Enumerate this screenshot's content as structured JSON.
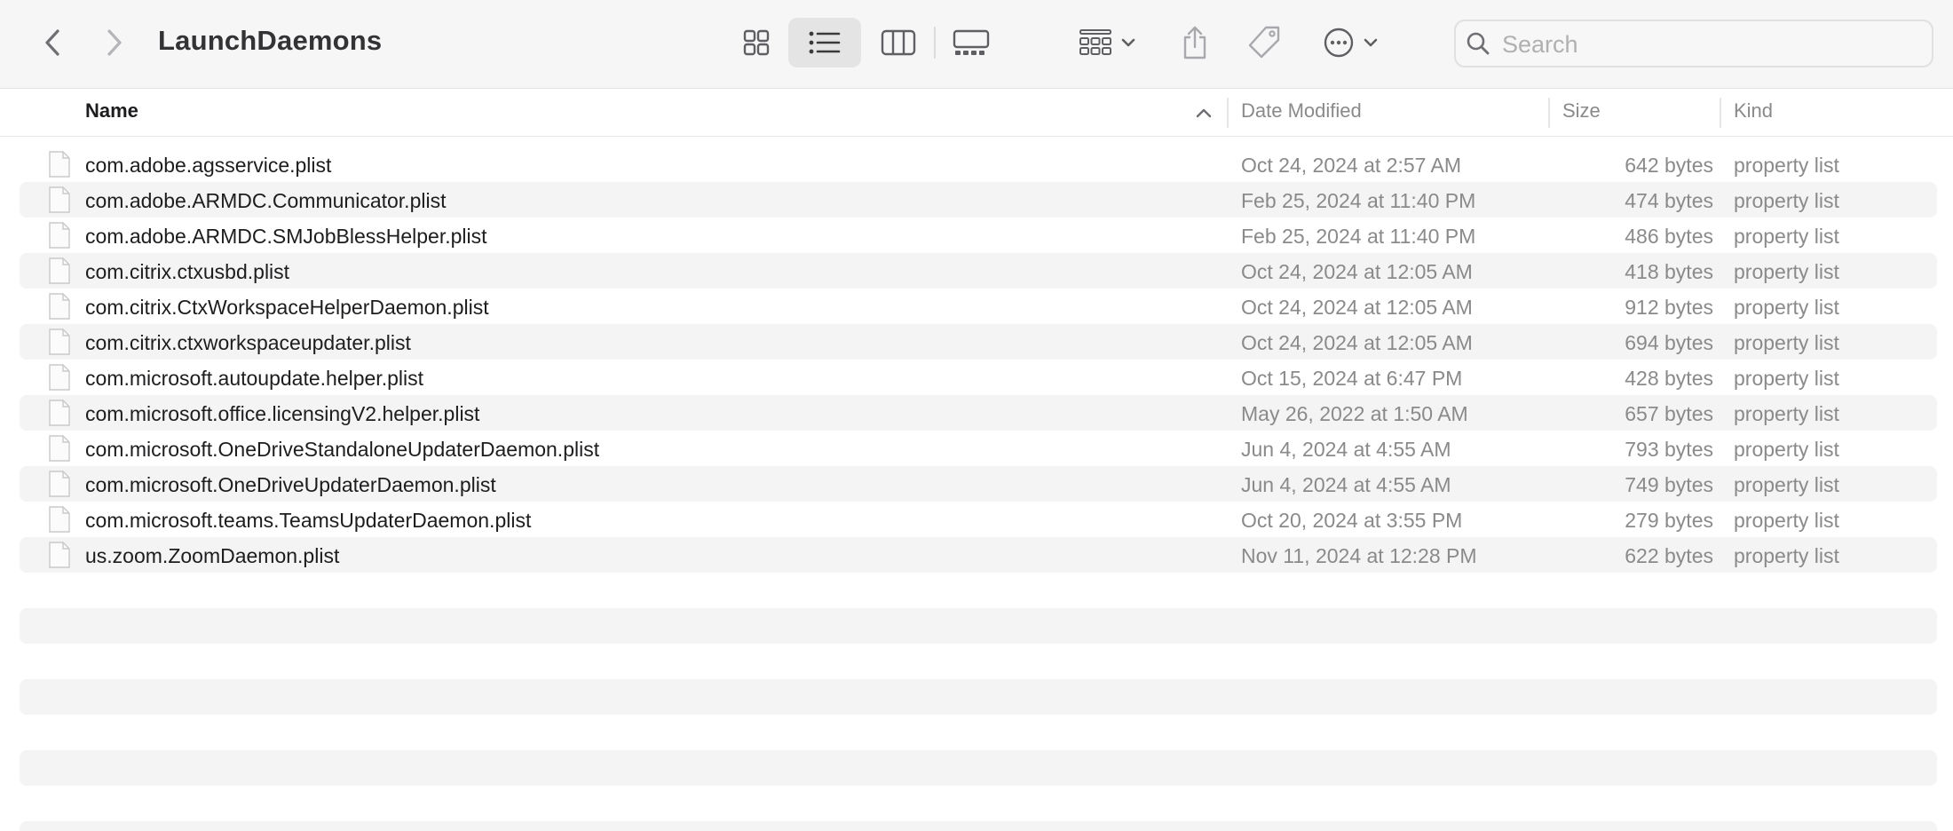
{
  "window": {
    "title": "LaunchDaemons"
  },
  "toolbar": {
    "back_icon": "chevron-left-icon",
    "forward_icon": "chevron-right-icon",
    "view_modes": [
      "icon-view-icon",
      "list-view-icon",
      "column-view-icon",
      "gallery-view-icon"
    ],
    "selected_view": "list-view-icon",
    "group_icon": "group-by-icon",
    "share_icon": "share-icon",
    "tags_icon": "tag-icon",
    "more_icon": "ellipsis-circle-icon"
  },
  "search": {
    "placeholder": "Search",
    "value": ""
  },
  "columns": {
    "name": "Name",
    "date": "Date Modified",
    "size": "Size",
    "kind": "Kind",
    "sort": "name-ascending"
  },
  "files": [
    {
      "name": "com.adobe.agsservice.plist",
      "date": "Oct 24, 2024 at 2:57 AM",
      "size": "642 bytes",
      "kind": "property list"
    },
    {
      "name": "com.adobe.ARMDC.Communicator.plist",
      "date": "Feb 25, 2024 at 11:40 PM",
      "size": "474 bytes",
      "kind": "property list"
    },
    {
      "name": "com.adobe.ARMDC.SMJobBlessHelper.plist",
      "date": "Feb 25, 2024 at 11:40 PM",
      "size": "486 bytes",
      "kind": "property list"
    },
    {
      "name": "com.citrix.ctxusbd.plist",
      "date": "Oct 24, 2024 at 12:05 AM",
      "size": "418 bytes",
      "kind": "property list"
    },
    {
      "name": "com.citrix.CtxWorkspaceHelperDaemon.plist",
      "date": "Oct 24, 2024 at 12:05 AM",
      "size": "912 bytes",
      "kind": "property list"
    },
    {
      "name": "com.citrix.ctxworkspaceupdater.plist",
      "date": "Oct 24, 2024 at 12:05 AM",
      "size": "694 bytes",
      "kind": "property list"
    },
    {
      "name": "com.microsoft.autoupdate.helper.plist",
      "date": "Oct 15, 2024 at 6:47 PM",
      "size": "428 bytes",
      "kind": "property list"
    },
    {
      "name": "com.microsoft.office.licensingV2.helper.plist",
      "date": "May 26, 2022 at 1:50 AM",
      "size": "657 bytes",
      "kind": "property list"
    },
    {
      "name": "com.microsoft.OneDriveStandaloneUpdaterDaemon.plist",
      "date": "Jun 4, 2024 at 4:55 AM",
      "size": "793 bytes",
      "kind": "property list"
    },
    {
      "name": "com.microsoft.OneDriveUpdaterDaemon.plist",
      "date": "Jun 4, 2024 at 4:55 AM",
      "size": "749 bytes",
      "kind": "property list"
    },
    {
      "name": "com.microsoft.teams.TeamsUpdaterDaemon.plist",
      "date": "Oct 20, 2024 at 3:55 PM",
      "size": "279 bytes",
      "kind": "property list"
    },
    {
      "name": "us.zoom.ZoomDaemon.plist",
      "date": "Nov 11, 2024 at 12:28 PM",
      "size": "622 bytes",
      "kind": "property list"
    }
  ],
  "colors": {
    "toolbar_bg": "#f6f6f6",
    "alt_row": "#f4f4f4",
    "secondary_text": "#8a8a8a",
    "primary_text": "#1d1d1f"
  }
}
